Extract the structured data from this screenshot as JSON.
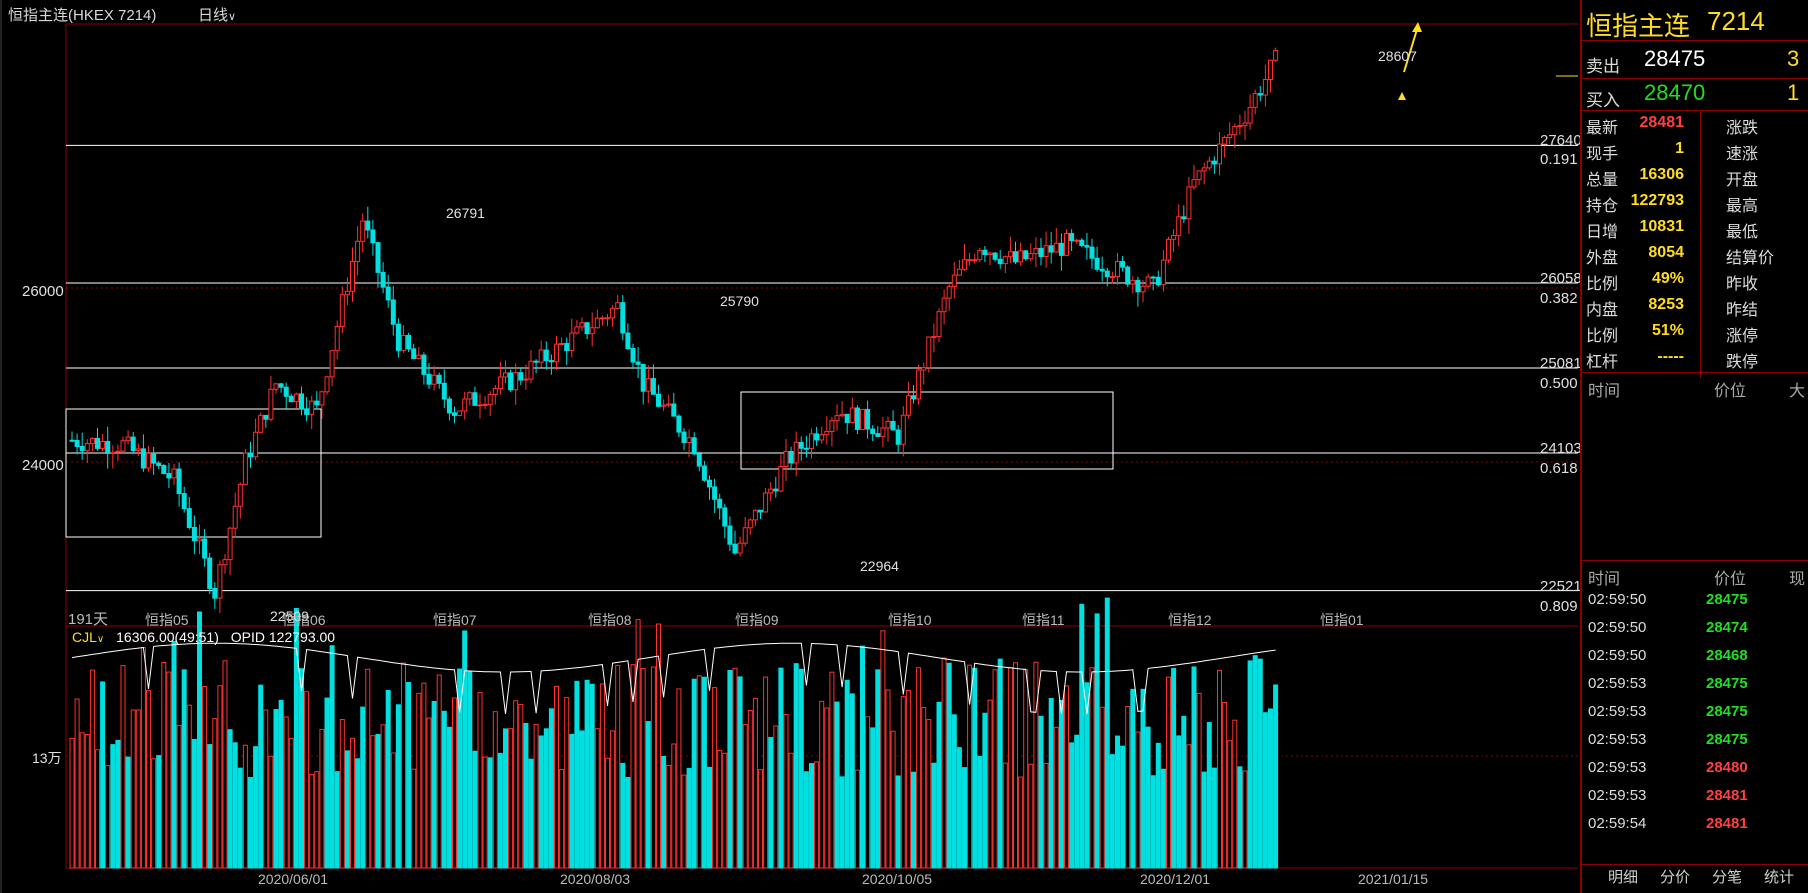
{
  "header": {
    "instrument": "恒指主连(HKEX 7214)",
    "period": "日线",
    "period_arrow": "chevron-down-icon"
  },
  "chart_data": {
    "type": "candlestick",
    "price_ticks": [
      "26000",
      "24000"
    ],
    "fib_levels": [
      {
        "price": "27640",
        "ratio": "0.191"
      },
      {
        "price": "26058",
        "ratio": "0.382"
      },
      {
        "price": "25081",
        "ratio": "0.500"
      },
      {
        "price": "24103",
        "ratio": "0.618"
      },
      {
        "price": "22521",
        "ratio": "0.809"
      }
    ],
    "annotations": [
      "26791",
      "25790",
      "22964",
      "22509",
      "28607"
    ],
    "month_labels": [
      "恒指05",
      "恒指06",
      "恒指07",
      "恒指08",
      "恒指09",
      "恒指10",
      "恒指11",
      "恒指12",
      "恒指01"
    ],
    "bar_count_label": "191天",
    "volume": {
      "indicator": "CJL",
      "readout": "16306.00(49:51)",
      "opid": "OPID 122793.00",
      "tick": "13万"
    },
    "date_labels": [
      "2020/06/01",
      "2020/08/03",
      "2020/10/05",
      "2020/12/01",
      "2021/01/15"
    ],
    "colors": {
      "up": "#ff3030",
      "down": "#00e0e0",
      "grid": "#ffffff",
      "frame": "#8b0000"
    }
  },
  "quote": {
    "title": "恒指主连",
    "code": "7214",
    "sell_label": "卖出",
    "sell_price": "28475",
    "sell_qty": "3",
    "buy_label": "买入",
    "buy_price": "28470",
    "buy_qty": "1",
    "stats": [
      {
        "label": "最新",
        "value": "28481",
        "label2": "涨跌",
        "color": "red"
      },
      {
        "label": "现手",
        "value": "1",
        "label2": "速涨",
        "color": "yellow"
      },
      {
        "label": "总量",
        "value": "16306",
        "label2": "开盘",
        "color": "yellow"
      },
      {
        "label": "持仓",
        "value": "122793",
        "label2": "最高",
        "color": "yellow"
      },
      {
        "label": "日增",
        "value": "10831",
        "label2": "最低",
        "color": "yellow"
      },
      {
        "label": "外盘",
        "value": "8054",
        "label2": "结算价",
        "color": "yellow"
      },
      {
        "label": "比例",
        "value": "49%",
        "label2": "昨收",
        "color": "yellow"
      },
      {
        "label": "内盘",
        "value": "8253",
        "label2": "昨结",
        "color": "yellow"
      },
      {
        "label": "比例",
        "value": "51%",
        "label2": "涨停",
        "color": "yellow"
      },
      {
        "label": "杠杆",
        "value": "-----",
        "label2": "跌停",
        "color": "yellow"
      }
    ],
    "header1": {
      "time": "时间",
      "price": "价位",
      "col3": "大"
    },
    "header2": {
      "time": "时间",
      "price": "价位",
      "col3": "现"
    },
    "ticks": [
      {
        "time": "02:59:50",
        "price": "28475",
        "color": "green"
      },
      {
        "time": "02:59:50",
        "price": "28474",
        "color": "green"
      },
      {
        "time": "02:59:50",
        "price": "28468",
        "color": "green"
      },
      {
        "time": "02:59:53",
        "price": "28475",
        "color": "green"
      },
      {
        "time": "02:59:53",
        "price": "28475",
        "color": "green"
      },
      {
        "time": "02:59:53",
        "price": "28475",
        "color": "green"
      },
      {
        "time": "02:59:53",
        "price": "28480",
        "color": "red"
      },
      {
        "time": "02:59:53",
        "price": "28481",
        "color": "red"
      },
      {
        "time": "02:59:54",
        "price": "28481",
        "color": "red"
      }
    ],
    "tabs": [
      "明细",
      "分价",
      "分笔",
      "统计"
    ]
  }
}
